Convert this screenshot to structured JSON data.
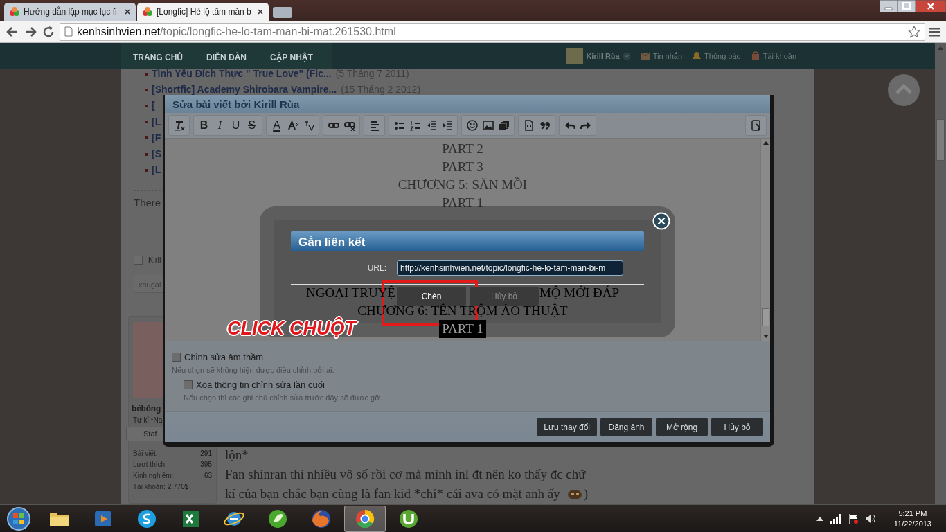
{
  "browser": {
    "tabs": [
      {
        "title": "Hướng dẫn lập mục lục fi",
        "selected": false
      },
      {
        "title": "[Longfic] Hé lộ tấm màn b",
        "selected": true
      }
    ],
    "address": {
      "domain": "kenhsinhvien.net",
      "path": "/topic/longfic-he-lo-tam-man-bi-mat.261530.html"
    }
  },
  "site_nav": {
    "items": [
      {
        "label": "TRANG CHỦ"
      },
      {
        "label": "DIỄN ĐÀN"
      },
      {
        "label": "CẬP NHẬT"
      }
    ],
    "user": "Kirill Rùa",
    "links": [
      "Tin nhắn",
      "Thông báo",
      "Tài khoản"
    ]
  },
  "page": {
    "thread_list": [
      {
        "title": "Tình Yêu Đích Thực \" True Love\" (Fic...",
        "date": "(5 Tháng 7 2011)"
      },
      {
        "title": "[Shortfic] Academy Shirobara Vampire...",
        "date": "(15 Tháng 2 2012)"
      },
      {
        "title": "["
      },
      {
        "title": "[L"
      },
      {
        "title": "[F"
      },
      {
        "title": "[S"
      },
      {
        "title": "[L"
      }
    ],
    "notice": "There",
    "watch_option": {
      "label": "Kiril",
      "checked": false
    },
    "tag_field": {
      "value": "xaugai"
    },
    "profile": {
      "name": "bébông",
      "title": "Tự kỉ *Na",
      "role": "Staf",
      "stats": [
        {
          "label": "Bài viết:",
          "value": "291",
          "inline": false
        },
        {
          "label": "Lượt thích:",
          "value": "395",
          "inline": false
        },
        {
          "label": "Kinh nghiệm:",
          "value": "63",
          "inline": false
        },
        {
          "label": "Tài khoản:",
          "value": "2.770$",
          "inline": true
        }
      ]
    },
    "post_lines": [
      {
        "text": "lộn*",
        "emoticon": false
      },
      {
        "text": "Fan shinran thì nhiều vô số rồi cơ mà mình inl đt nên ko thấy đc chữ",
        "emoticon": false
      },
      {
        "text": "kí của bạn chắc bạn cũng là fan kid *chỉ* cái ava có mặt anh ấy",
        "emoticon": true,
        "tail": ")"
      }
    ]
  },
  "edit_dialog": {
    "title": "Sửa bài viết bởi Kirill Rùa",
    "toolbar": [
      [
        {
          "kind": "icon"
        }
      ],
      [
        {
          "kind": "bold",
          "label": "B"
        },
        {
          "kind": "italic",
          "label": "I"
        },
        {
          "kind": "underline",
          "label": "U"
        },
        {
          "kind": "strike",
          "label": "S"
        }
      ],
      [
        {
          "kind": "color",
          "label": "A"
        },
        {
          "kind": "icon"
        },
        {
          "kind": "icon"
        }
      ],
      [
        {
          "kind": "icon"
        },
        {
          "kind": "icon"
        }
      ],
      [
        {
          "kind": "icon"
        }
      ],
      [
        {
          "kind": "icon"
        },
        {
          "kind": "icon"
        },
        {
          "kind": "icon"
        },
        {
          "kind": "icon"
        }
      ],
      [
        {
          "kind": "icon"
        },
        {
          "kind": "icon"
        },
        {
          "kind": "icon"
        }
      ],
      [
        {
          "kind": "icon"
        },
        {
          "kind": "icon"
        }
      ],
      [
        {
          "kind": "icon"
        },
        {
          "kind": "icon"
        }
      ]
    ],
    "toolbar_end": [
      {
        "kind": "icon"
      }
    ],
    "content": [
      {
        "parts": [
          "PART 2"
        ],
        "selected": false
      },
      {
        "parts": [
          "PART 3"
        ],
        "selected": false
      },
      {
        "parts": [
          "CHƯƠNG 5: SĂN MỒI"
        ],
        "selected": false
      },
      {
        "parts": [
          "PART 1"
        ],
        "selected": false
      }
    ],
    "content_lower": [
      {
        "parts": [
          "NGOẠI TRUYỆ",
          "MỘ MỚI ĐÁP"
        ],
        "selected": false
      },
      {
        "parts": [
          "CHƯƠNG 6: TÊN TRỘM ẢO THUẬT"
        ],
        "selected": false
      },
      {
        "parts": [
          "PART 1"
        ],
        "selected": true
      }
    ],
    "options": [
      {
        "label": "Chỉnh sửa âm thầm",
        "hint": "Nếu chọn sẽ không hiện được điều chỉnh bởi ai.",
        "checked": false,
        "nested": false
      },
      {
        "label": "Xóa thông tin chỉnh sửa lần cuối",
        "hint": "Nếu chọn thì các ghi chú chỉnh sửa trước đây sẽ được gỡ.",
        "checked": false,
        "nested": true
      }
    ],
    "buttons": [
      "Lưu thay đổi",
      "Đăng ảnh",
      "Mở rộng",
      "Hủy bỏ"
    ]
  },
  "link_dialog": {
    "title": "Gắn liên kết",
    "url_label": "URL:",
    "url_value": "http://kenhsinhvien.net/topic/longfic-he-lo-tam-man-bi-m",
    "buttons": [
      {
        "label": "Chèn",
        "highlighted": true,
        "disabled": false
      },
      {
        "label": "Hủy bỏ",
        "highlighted": false,
        "disabled": true
      }
    ]
  },
  "annotation": "CLICK CHUỘT",
  "taskbar": {
    "apps": [
      {
        "selected": false
      },
      {
        "selected": false
      },
      {
        "selected": false
      },
      {
        "selected": false
      },
      {
        "selected": false
      },
      {
        "selected": false
      },
      {
        "selected": false
      },
      {
        "selected": true
      },
      {
        "selected": false
      }
    ],
    "time": "5:21 PM",
    "date": "11/22/2013"
  }
}
